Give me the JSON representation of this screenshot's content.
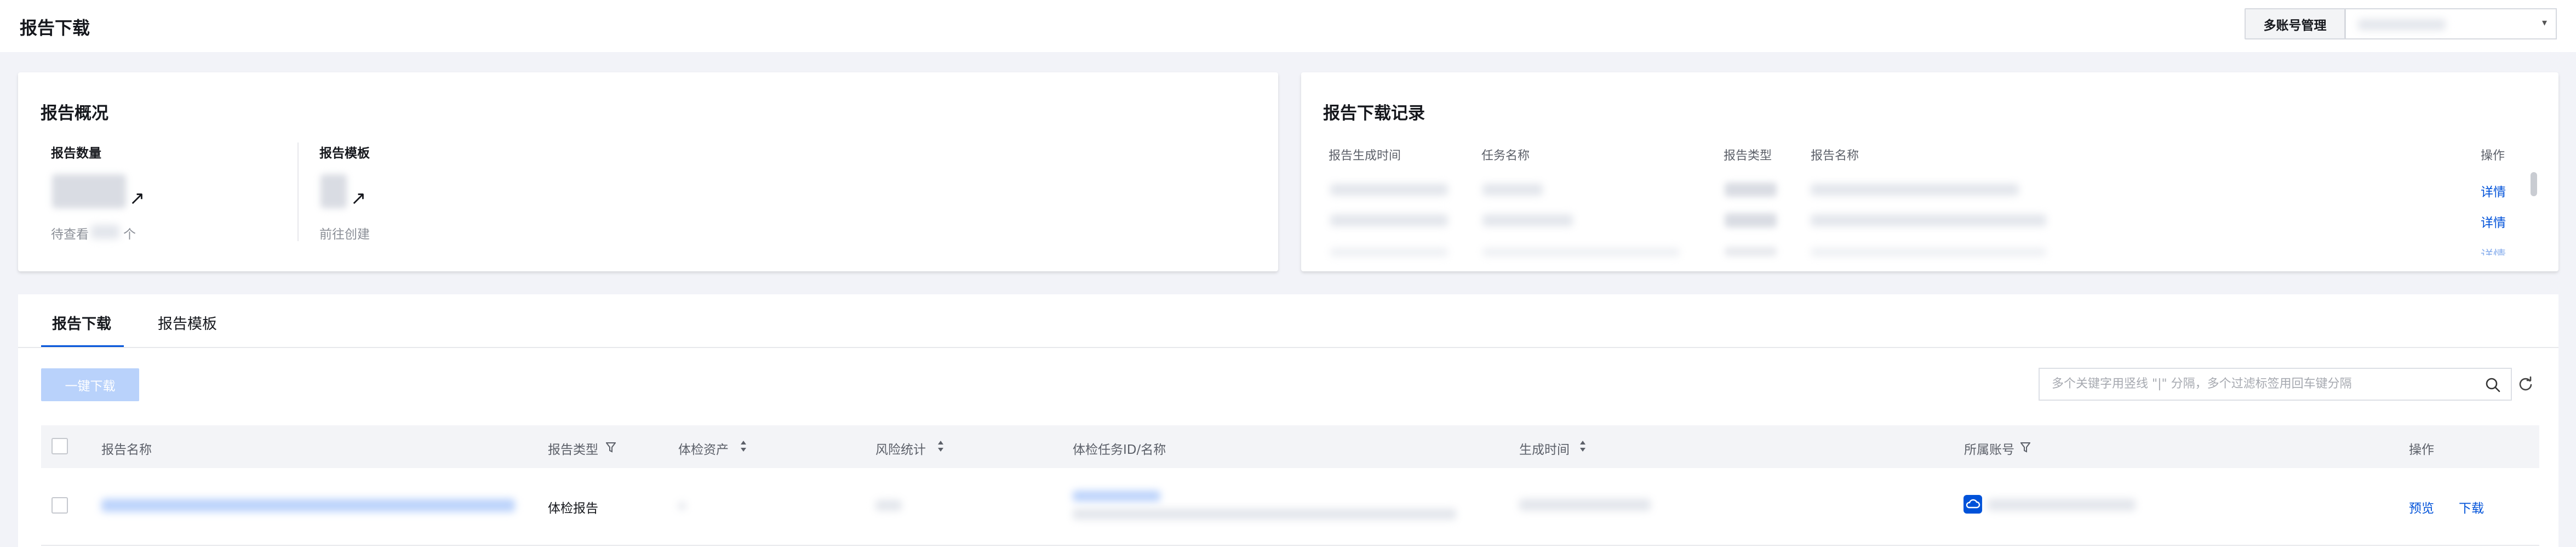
{
  "header": {
    "title": "报告下载",
    "multi_account_label": "多账号管理",
    "caret": "▾"
  },
  "overview": {
    "title": "报告概况",
    "report_count_label": "报告数量",
    "pending_prefix": "待查看",
    "pending_suffix": "个",
    "template_label": "报告模板",
    "go_create": "前往创建",
    "arrow": "↗"
  },
  "records": {
    "title": "报告下载记录",
    "columns": [
      "报告生成时间",
      "任务名称",
      "报告类型",
      "报告名称",
      "操作"
    ],
    "row_action": "详情"
  },
  "tabs": [
    "报告下载",
    "报告模板"
  ],
  "toolbar": {
    "batch_download": "一键下载",
    "search_placeholder": "多个关键字用竖线 \"|\" 分隔，多个过滤标签用回车键分隔"
  },
  "table": {
    "columns": [
      "报告名称",
      "报告类型",
      "体检资产",
      "风险统计",
      "体检任务ID/名称",
      "生成时间",
      "所属账号",
      "操作"
    ],
    "row": {
      "type": "体检报告",
      "action_preview": "预览",
      "action_download": "下载"
    }
  },
  "colors": {
    "primary": "#0052d9",
    "disabled_button": "#b9d2fb",
    "page_bg": "#f2f3f8"
  }
}
